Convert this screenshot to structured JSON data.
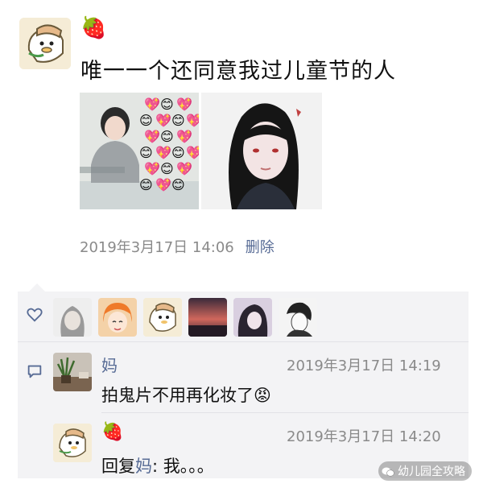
{
  "post": {
    "author_emoji": "🍓",
    "text": "唯一一个还同意我过儿童节的人",
    "timestamp": "2019年3月17日 14:06",
    "delete_label": "删除",
    "heart_emoji": "💖😊"
  },
  "likes": {
    "count": 6
  },
  "comments": [
    {
      "author": "妈",
      "time": "2019年3月17日 14:19",
      "text": "拍鬼片不用再化妆了",
      "emoji": "😡"
    },
    {
      "author_emoji": "🍓",
      "time": "2019年3月17日 14:20",
      "reply_prefix": "回复",
      "reply_target": "妈",
      "reply_text": ": 我。。。"
    }
  ],
  "watermark": {
    "text": "幼儿园全攻略"
  },
  "colors": {
    "link": "#576b95",
    "meta": "#8a8a8a",
    "panel": "#f3f3f5"
  }
}
